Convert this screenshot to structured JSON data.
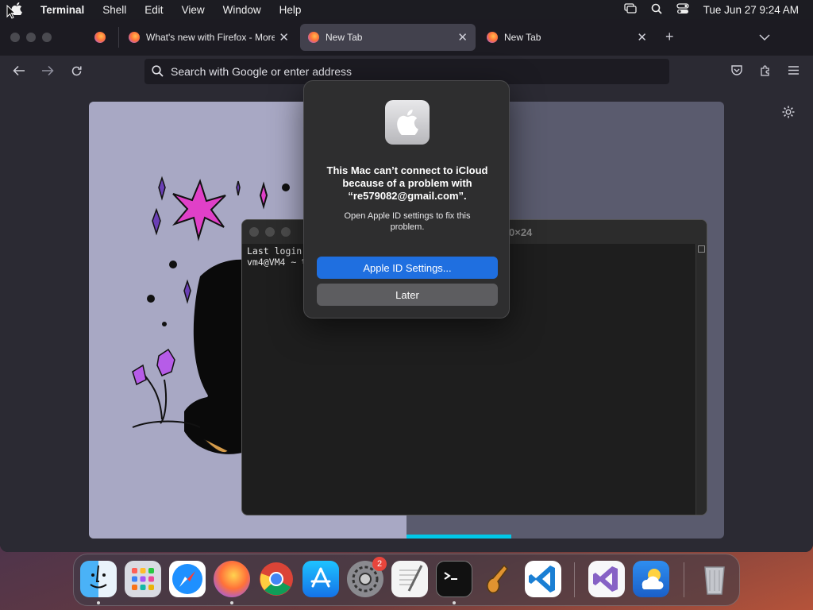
{
  "menubar": {
    "app": "Terminal",
    "menus": [
      "Shell",
      "Edit",
      "View",
      "Window",
      "Help"
    ],
    "clock": "Tue Jun 27  9:24 AM"
  },
  "browser": {
    "tabs": [
      {
        "title": "What's new with Firefox - More"
      },
      {
        "title": "New Tab"
      },
      {
        "title": "New Tab"
      }
    ],
    "url_placeholder": "Search with Google or enter address"
  },
  "terminal": {
    "title_suffix": "0×24",
    "lines": [
      "Last login",
      "vm4@VM4 ~ %"
    ]
  },
  "alert": {
    "message": "This Mac can’t connect to iCloud because of a problem with “re579082@gmail.com”.",
    "detail": "Open Apple ID settings to fix this problem.",
    "primary_button": "Apple ID Settings...",
    "secondary_button": "Later"
  },
  "dock": {
    "settings_badge": "2",
    "apps": [
      "finder",
      "launchpad",
      "safari",
      "firefox",
      "chrome",
      "app-store",
      "system-settings",
      "textedit",
      "terminal",
      "garageband",
      "vscode",
      "visual-studio",
      "weather",
      "trash"
    ]
  }
}
